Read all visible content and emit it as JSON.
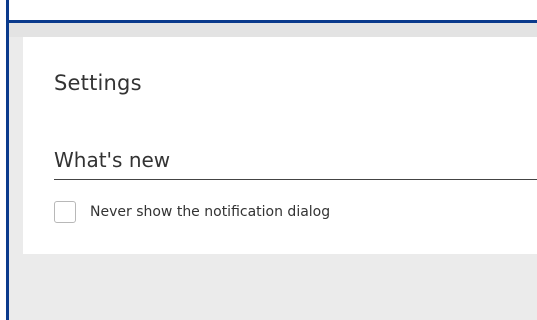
{
  "colors": {
    "accent": "#0a3a8c",
    "background": "#ebebeb",
    "card": "#ffffff",
    "text": "#333333"
  },
  "settings": {
    "title": "Settings",
    "section_title": "What's new",
    "option_label": "Never show the notification dialog",
    "option_checked": false
  }
}
